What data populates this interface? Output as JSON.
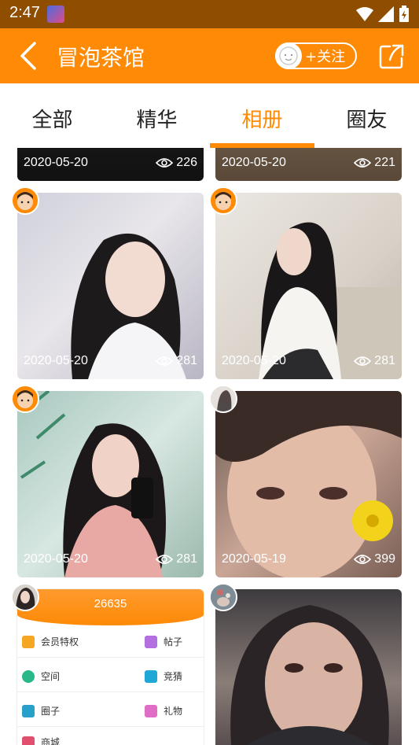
{
  "status": {
    "time": "2:47"
  },
  "header": {
    "title": "冒泡茶馆",
    "follow_label": "+关注"
  },
  "tabs": [
    {
      "label": "全部"
    },
    {
      "label": "精华"
    },
    {
      "label": "相册"
    },
    {
      "label": "圈友"
    }
  ],
  "active_tab": "相册",
  "colors": {
    "brand": "#fe8a06",
    "status_bar": "#8f4d00"
  },
  "photos": [
    {
      "date": "2020-05-20",
      "views": "226"
    },
    {
      "date": "2020-05-20",
      "views": "221"
    },
    {
      "date": "2020-05-20",
      "views": "281"
    },
    {
      "date": "2020-05-20",
      "views": "281"
    },
    {
      "date": "2020-05-20",
      "views": "281"
    },
    {
      "date": "2020-05-19",
      "views": "399"
    }
  ],
  "menu_card": {
    "number": "26635",
    "items": [
      "会员特权",
      "帖子",
      "空间",
      "竞猜",
      "圈子",
      "礼物",
      "商城"
    ]
  }
}
